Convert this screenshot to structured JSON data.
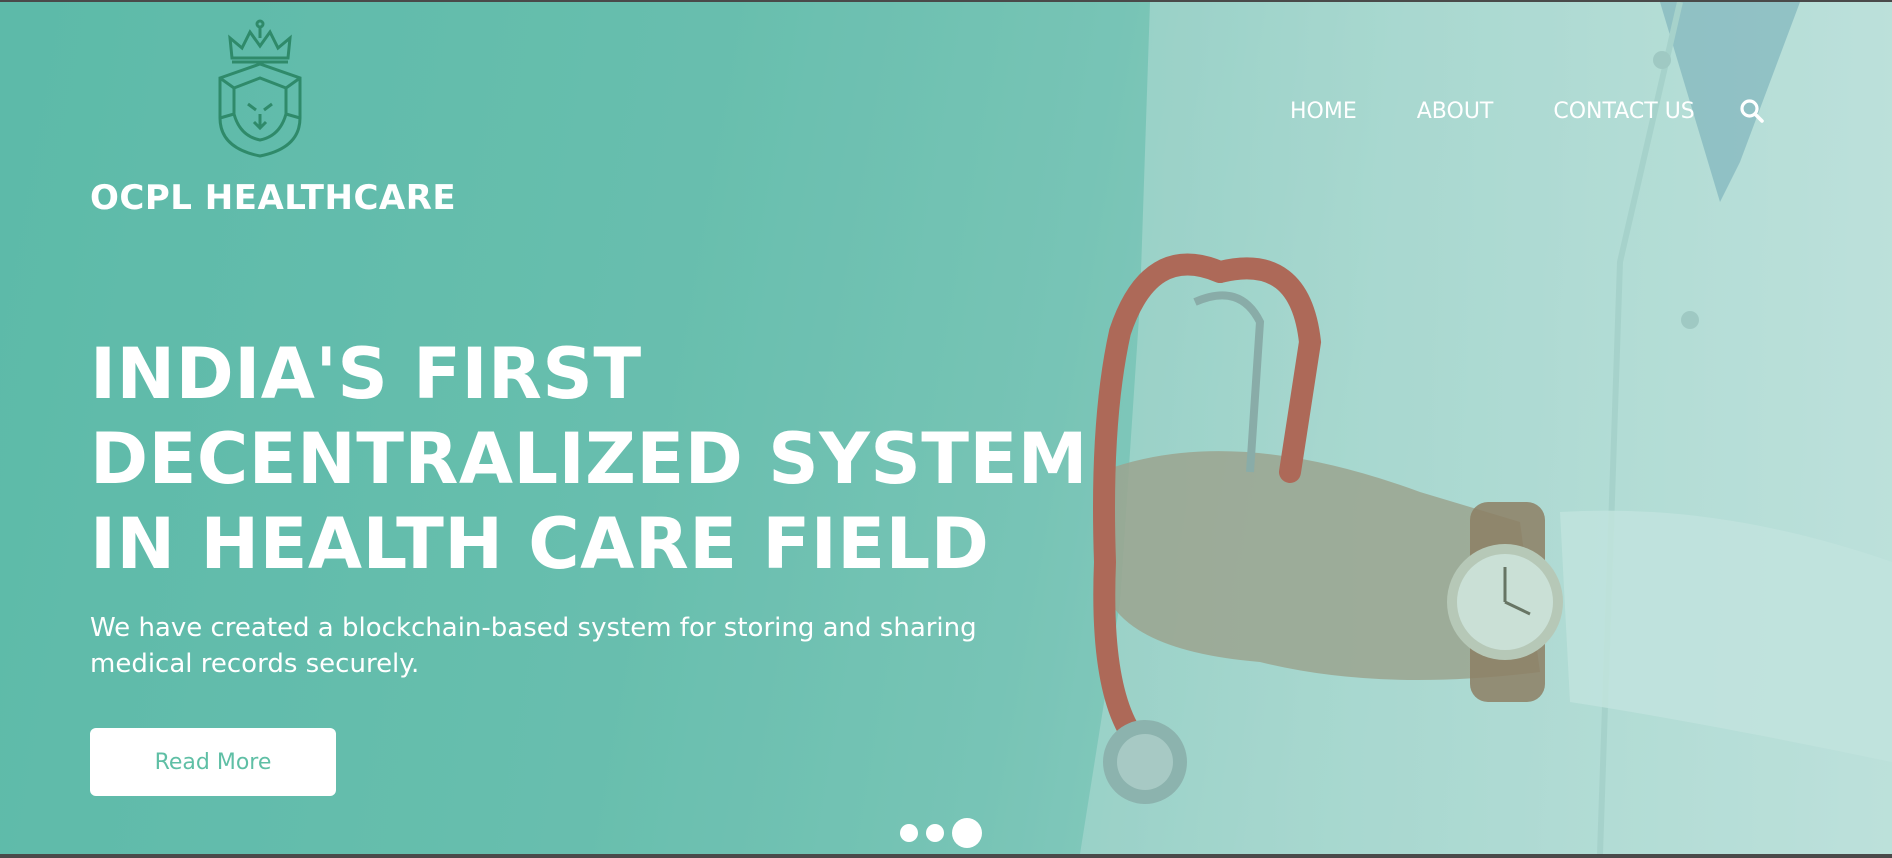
{
  "brand": {
    "name": "OCPL HEALTHCARE",
    "logo_icon": "lion-crown-icon"
  },
  "nav": {
    "items": [
      {
        "label": "HOME"
      },
      {
        "label": "ABOUT"
      },
      {
        "label": "CONTACT US"
      }
    ],
    "search_icon": "search-icon"
  },
  "hero": {
    "headline_lines": [
      "INDIA'S FIRST",
      "DECENTRALIZED SYSTEM",
      "IN HEALTH CARE FIELD"
    ],
    "subtext": "We have created a blockchain-based system for storing and sharing medical records securely.",
    "cta_label": "Read More",
    "background_image": "doctor-with-stethoscope-image"
  },
  "carousel": {
    "slide_count": 3,
    "active_index": 2
  },
  "colors": {
    "accent": "#5fbfa5",
    "overlay": "#62bcab",
    "text": "#ffffff"
  }
}
